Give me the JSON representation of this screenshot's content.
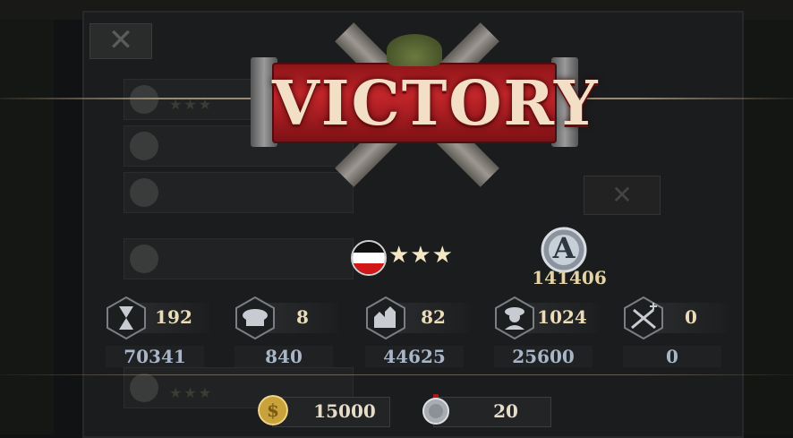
{
  "banner": {
    "title": "VICTORY"
  },
  "player": {
    "stars": "★★★",
    "flag_colors": [
      "#111111",
      "#ffffff",
      "#d01818"
    ],
    "score": "141406",
    "medal_letter": "A"
  },
  "stats": [
    {
      "icon": "hourglass-icon",
      "value": "192",
      "sub": "70341"
    },
    {
      "icon": "officer-cap-icon",
      "value": "8",
      "sub": "840"
    },
    {
      "icon": "buildings-icon",
      "value": "82",
      "sub": "44625"
    },
    {
      "icon": "soldier-icon",
      "value": "1024",
      "sub": "25600"
    },
    {
      "icon": "crossed-rifles-icon",
      "value": "0",
      "sub": "0"
    }
  ],
  "rewards": {
    "coins": "15000",
    "medals": "20"
  },
  "background": {
    "close_glyph": "✕",
    "row_stars": "★★★"
  },
  "colors": {
    "banner_red": "#c4262a",
    "gold_text": "#eadcb8",
    "sub_text": "#a9b6c8"
  }
}
